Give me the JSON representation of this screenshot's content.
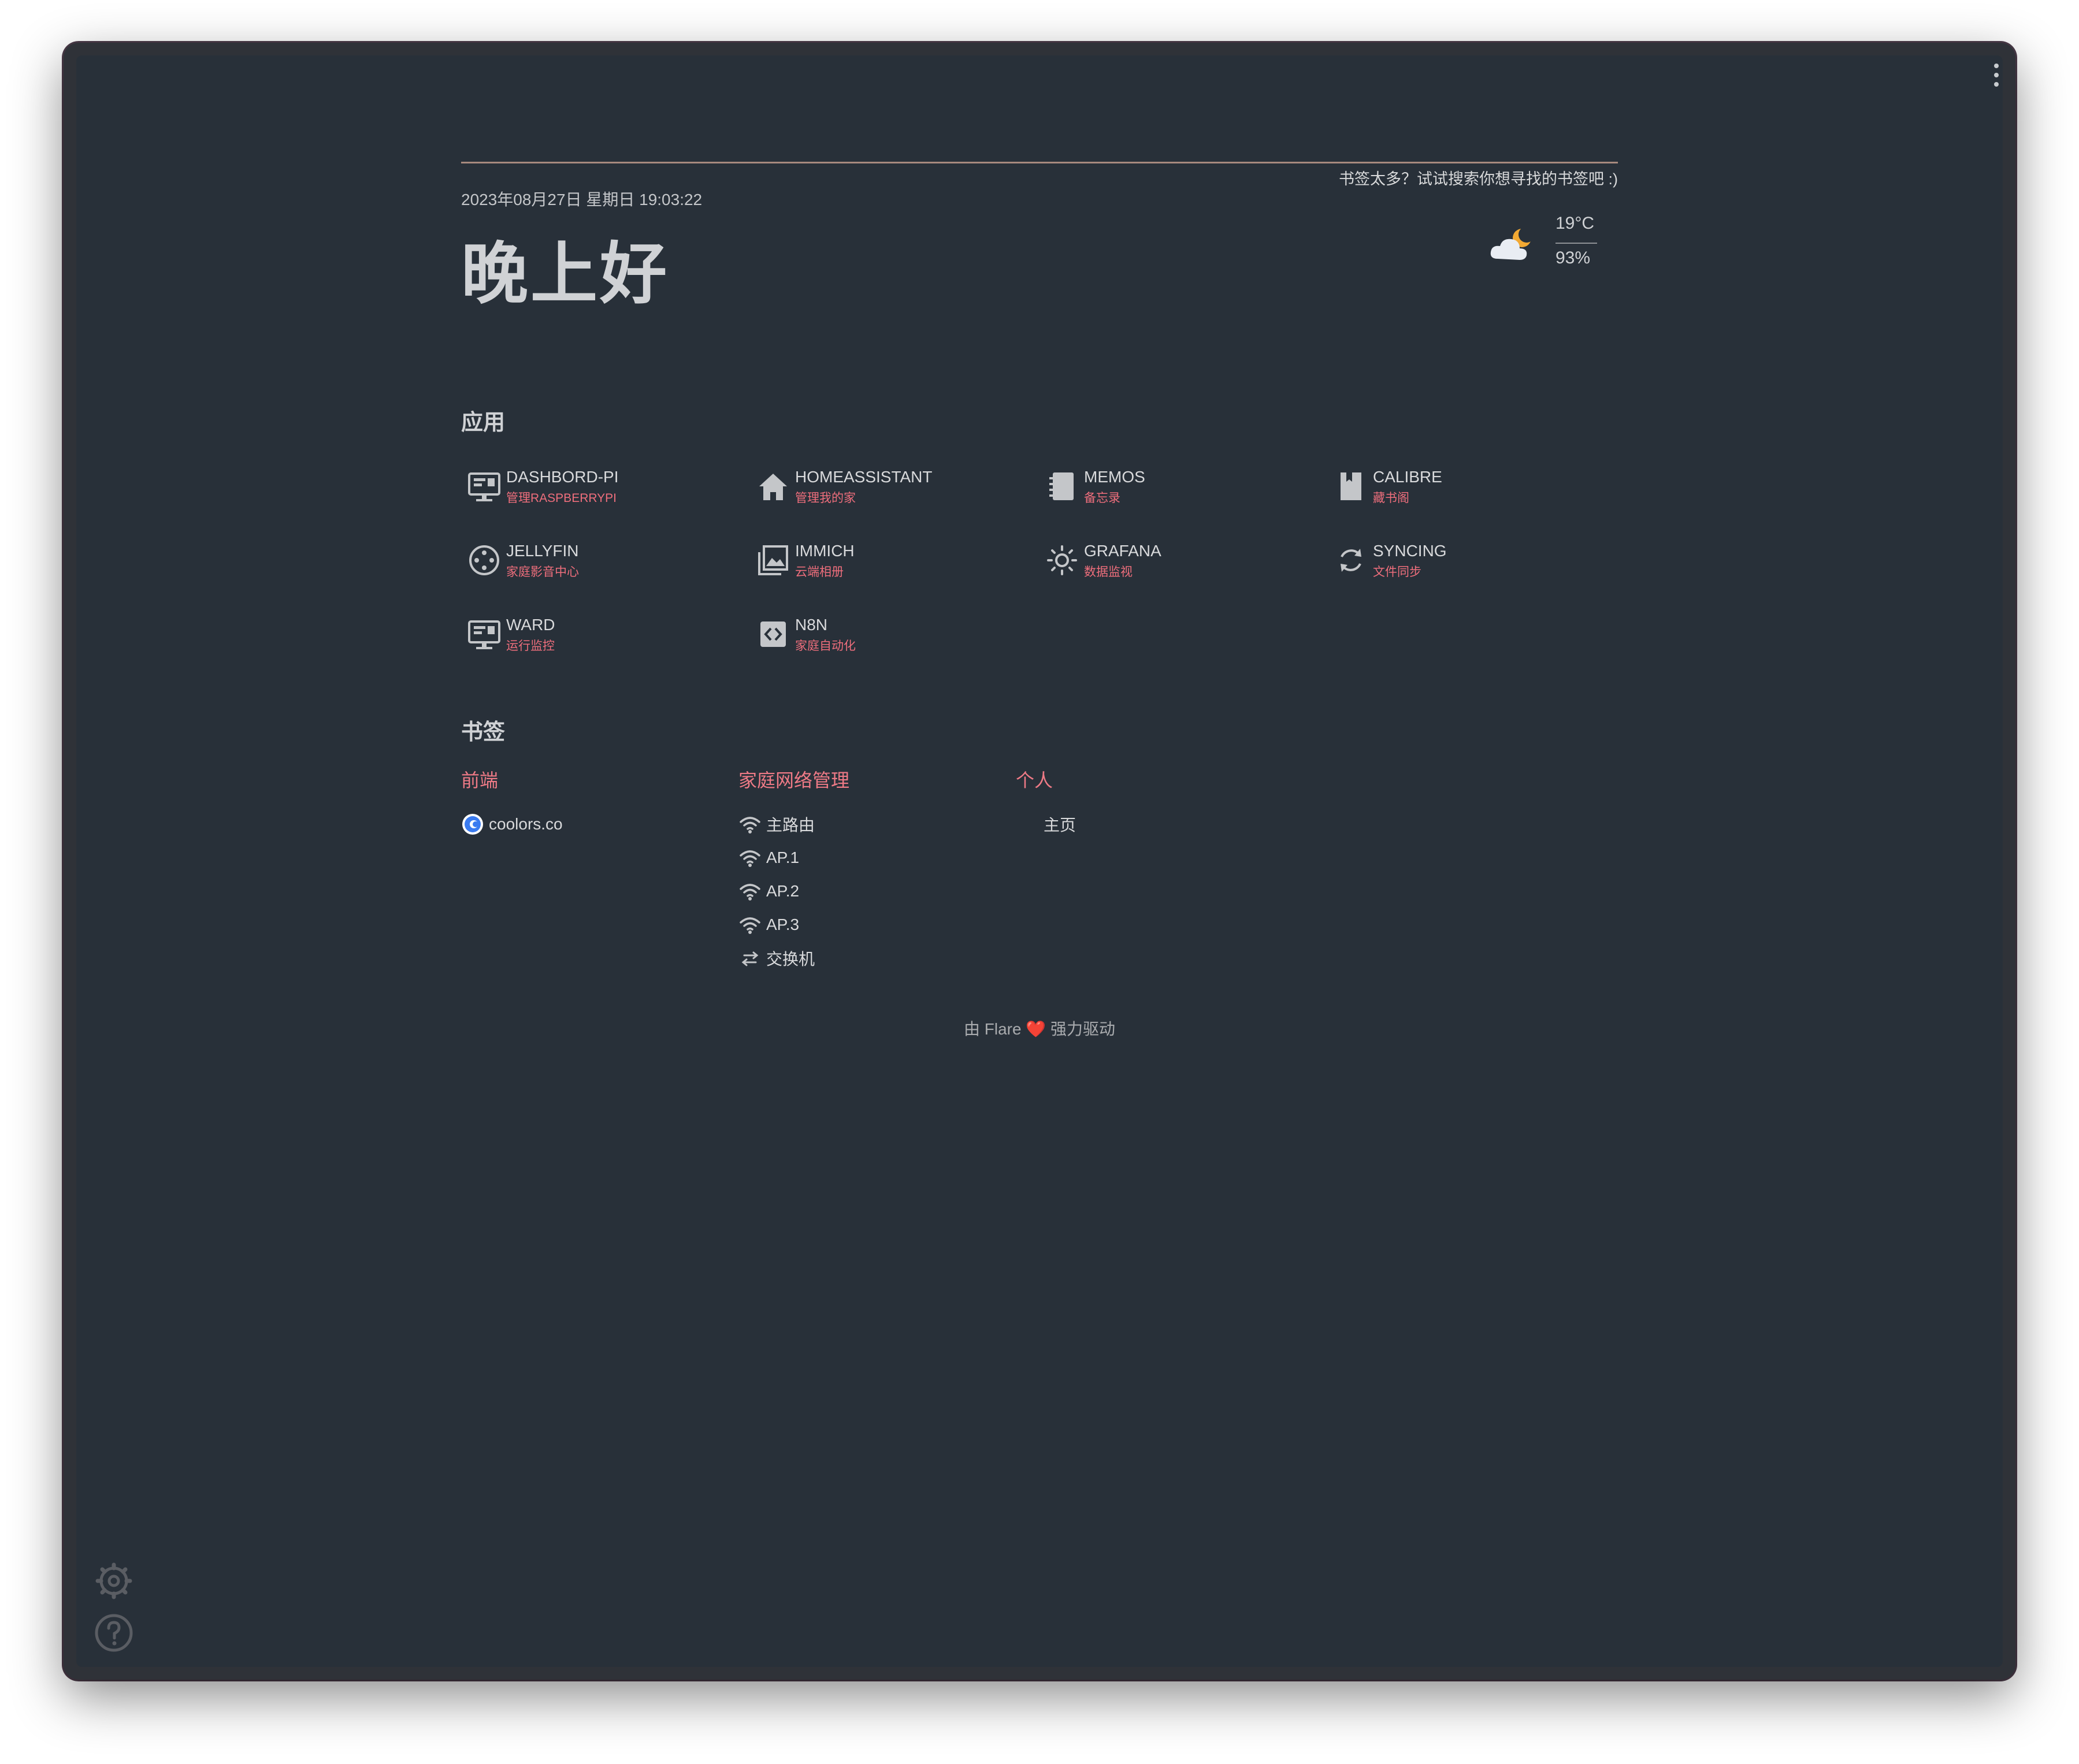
{
  "search": {
    "hint": "书签太多？试试搜索你想寻找的书签吧 :)"
  },
  "header": {
    "datetime": "2023年08月27日 星期日 19:03:22",
    "greeting": "晚上好"
  },
  "weather": {
    "icon": "cloud-moon-icon",
    "temperature": "19°C",
    "humidity": "93%"
  },
  "apps": {
    "title": "应用",
    "items": [
      {
        "name": "DASHBORD-PI",
        "desc": "管理RASPBERRYPI",
        "icon": "monitor-icon"
      },
      {
        "name": "HOMEASSISTANT",
        "desc": "管理我的家",
        "icon": "home-icon"
      },
      {
        "name": "MEMOS",
        "desc": "备忘录",
        "icon": "notebook-icon"
      },
      {
        "name": "CALIBRE",
        "desc": "藏书阁",
        "icon": "book-icon"
      },
      {
        "name": "JELLYFIN",
        "desc": "家庭影音中心",
        "icon": "film-reel-icon"
      },
      {
        "name": "IMMICH",
        "desc": "云端相册",
        "icon": "image-gallery-icon"
      },
      {
        "name": "GRAFANA",
        "desc": "数据监视",
        "icon": "sun-gear-icon"
      },
      {
        "name": "SYNCING",
        "desc": "文件同步",
        "icon": "sync-icon"
      },
      {
        "name": "WARD",
        "desc": "运行监控",
        "icon": "monitor-icon"
      },
      {
        "name": "N8N",
        "desc": "家庭自动化",
        "icon": "code-box-icon"
      }
    ]
  },
  "bookmarks": {
    "title": "书签",
    "groups": [
      {
        "title": "前端",
        "items": [
          {
            "label": "coolors.co",
            "icon": "coolors-logo-icon"
          }
        ]
      },
      {
        "title": "家庭网络管理",
        "items": [
          {
            "label": "主路由",
            "icon": "wifi-icon"
          },
          {
            "label": "AP.1",
            "icon": "wifi-icon"
          },
          {
            "label": "AP.2",
            "icon": "wifi-icon"
          },
          {
            "label": "AP.3",
            "icon": "wifi-icon"
          },
          {
            "label": "交换机",
            "icon": "switch-arrows-icon"
          }
        ]
      },
      {
        "title": "个人",
        "items": [
          {
            "label": "主页",
            "icon": ""
          }
        ]
      }
    ]
  },
  "footer": {
    "prefix": "由 Flare",
    "heart": "❤️",
    "suffix": "强力驱动"
  },
  "side": {
    "settings_icon": "gear-icon",
    "help_icon": "help-icon"
  },
  "colors": {
    "background": "#283039",
    "accent": "#ee6e7c",
    "text": "#d9dadc"
  }
}
